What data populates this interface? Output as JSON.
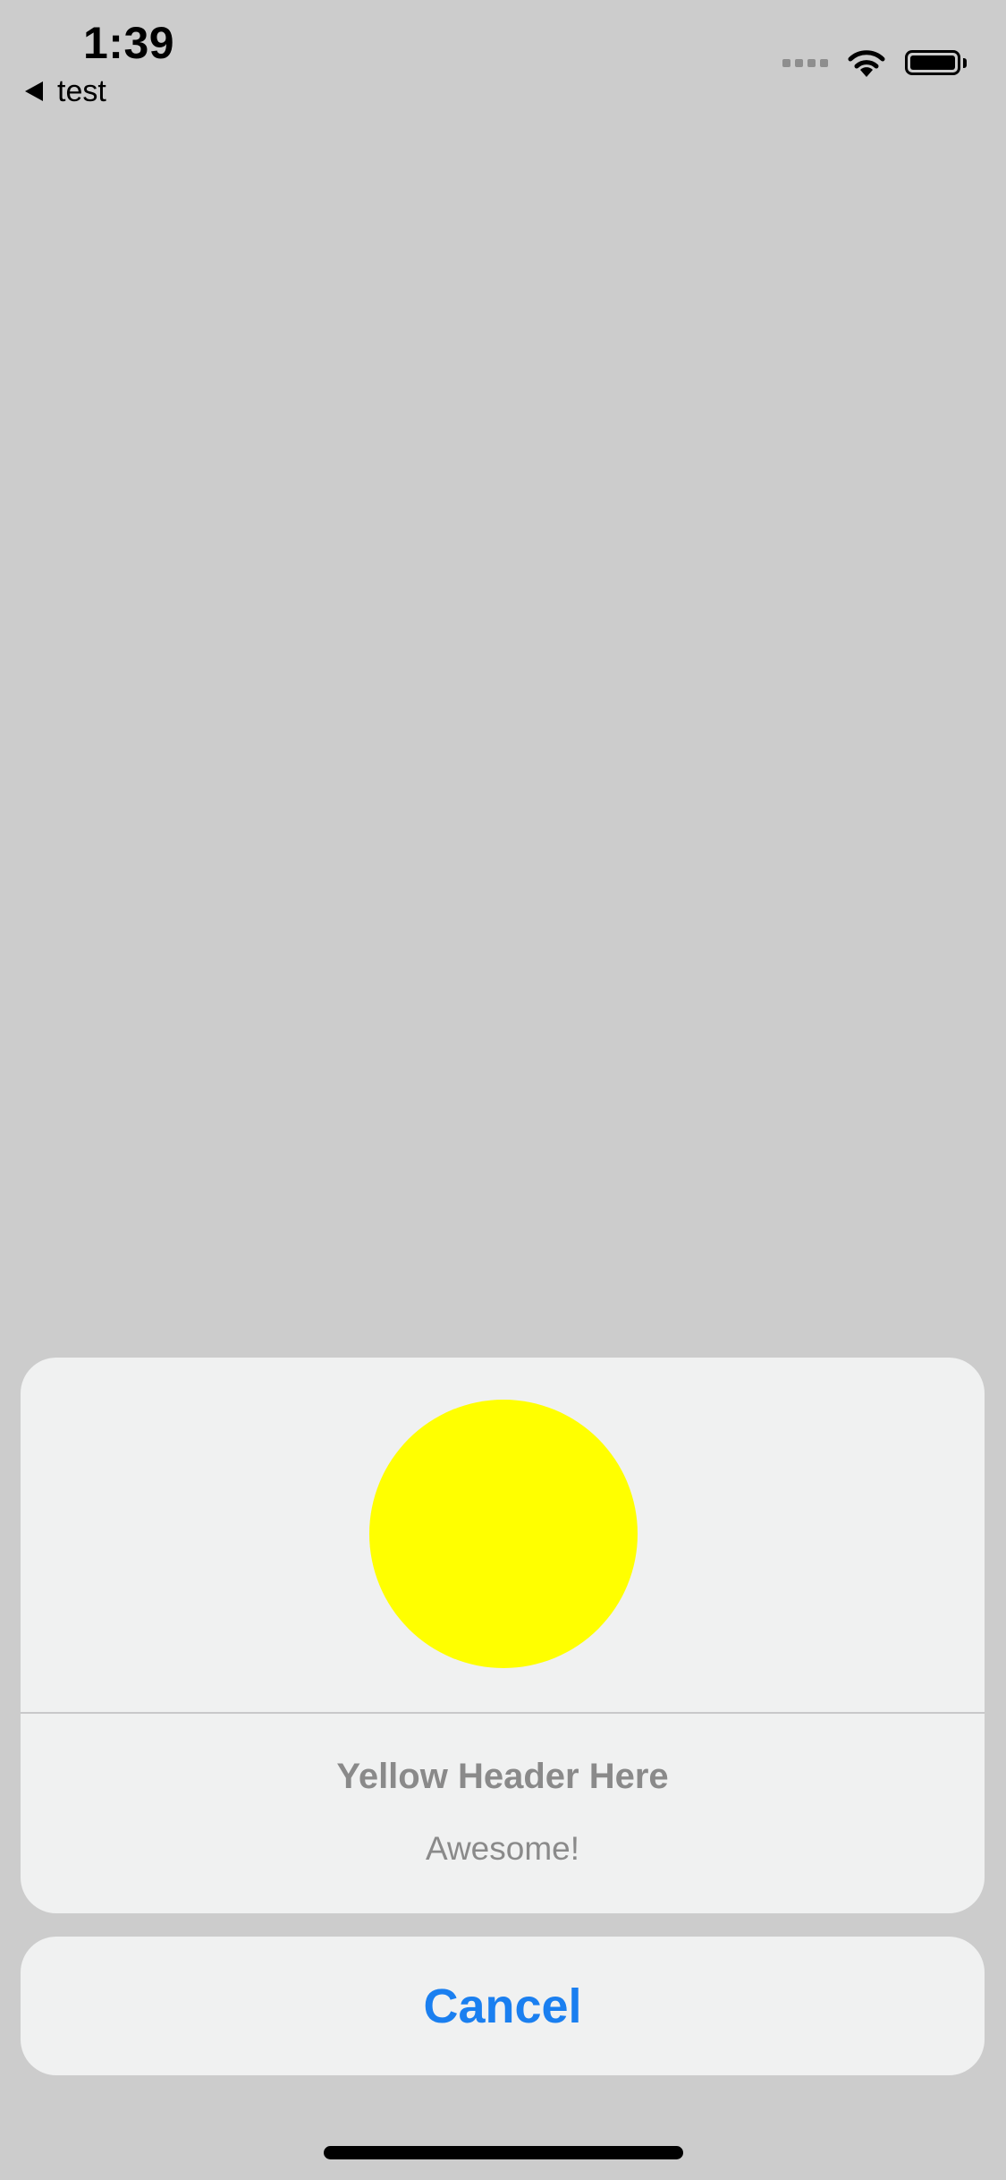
{
  "status_bar": {
    "time": "1:39",
    "back_label": "test",
    "icons": [
      "cellular-signal-icon",
      "wifi-icon",
      "battery-icon"
    ],
    "battery_level": 1.0
  },
  "action_sheet": {
    "header_circle_color": "#ffff00",
    "title": "Yellow Header Here",
    "message": "Awesome!",
    "cancel_label": "Cancel",
    "cancel_color": "#1a7ff0"
  },
  "colors": {
    "background": "#cccccc",
    "sheet_background": "#f0f1f1",
    "secondary_text": "#8a8a8a"
  }
}
